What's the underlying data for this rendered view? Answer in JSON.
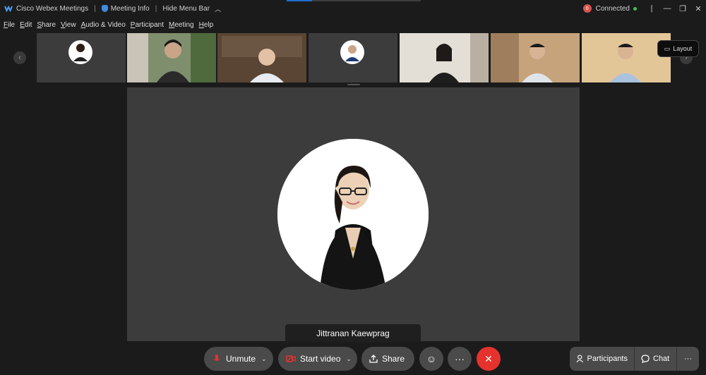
{
  "titlebar": {
    "app_name": "Cisco Webex Meetings",
    "meeting_info": "Meeting Info",
    "hide_menu_bar": "Hide Menu Bar",
    "status": "Connected",
    "rec_badge": "0"
  },
  "menu": [
    "File",
    "Edit",
    "Share",
    "View",
    "Audio & Video",
    "Participant",
    "Meeting",
    "Help"
  ],
  "layout_label": "Layout",
  "active_speaker": {
    "name": "Jittranan Kaewprag"
  },
  "controls": {
    "unmute": "Unmute",
    "start_video": "Start video",
    "share": "Share",
    "participants": "Participants",
    "chat": "Chat",
    "more": "···"
  },
  "colors": {
    "end_call": "#e5322d",
    "connected": "#3fbf5a",
    "record": "#d9534f"
  }
}
